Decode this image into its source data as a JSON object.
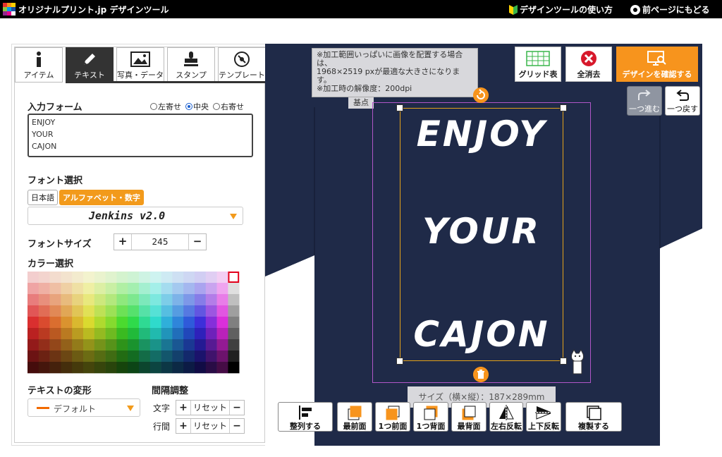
{
  "header": {
    "title": "オリジナルプリント.jp デザインツール",
    "howto_label": "デザインツールの使い方",
    "back_label": "前ページにもどる"
  },
  "tabs": [
    {
      "label": "アイテム",
      "icon": "info-icon"
    },
    {
      "label": "テキスト",
      "icon": "pen-icon",
      "active": true
    },
    {
      "label": "写真・データ",
      "icon": "image-icon"
    },
    {
      "label": "スタンプ",
      "icon": "stamp-icon"
    },
    {
      "label": "テンプレート",
      "icon": "template-icon"
    }
  ],
  "text_panel": {
    "input_label": "入力フォーム",
    "align_options": [
      "左寄せ",
      "中央",
      "右寄せ"
    ],
    "align_selected": "中央",
    "input_value": "ENJOY\nYOUR\nCAJON",
    "font_label": "フォント選択",
    "font_type_options": [
      "日本語",
      "アルファベット・数字"
    ],
    "font_type_selected": "アルファベット・数字",
    "font_value": "Jenkins v2.0",
    "font_size_label": "フォントサイズ",
    "font_size_value": "245",
    "color_label": "カラー選択",
    "transform_label": "テキストの変形",
    "transform_value": "デフォルト",
    "spacing_label": "間隔調整",
    "char_spacing_label": "文字",
    "line_spacing_label": "行間",
    "reset_label": "リセット"
  },
  "colors": {
    "accent": "#f7941d",
    "shirt": "#1f2a48",
    "print_area_border": "#b056c8",
    "selection_border": "#e3a21a"
  },
  "canvas": {
    "notice": "※加工範囲いっぱいに画像を配置する場合は、\n1968×2519 pxが最適な大きさになります。\n※加工時の解像度：200dpi",
    "basepoint_label": "基点",
    "design_lines": [
      "ENJOY",
      "YOUR",
      "CAJON"
    ],
    "size_info": "サイズ（横×縦）：187×289mm"
  },
  "toolbar_top": {
    "grid_label": "グリッド表",
    "clear_label": "全消去",
    "confirm_label": "デザインを確認する",
    "redo_label": "一つ進む",
    "undo_label": "一つ戻す"
  },
  "toolbar_bottom": {
    "align_label": "整列する",
    "front_label": "最前面",
    "forward_label": "1つ前面",
    "backward_label": "1つ背面",
    "back_label": "最背面",
    "flip_h_label": "左右反転",
    "flip_v_label": "上下反転",
    "duplicate_label": "複製する"
  }
}
